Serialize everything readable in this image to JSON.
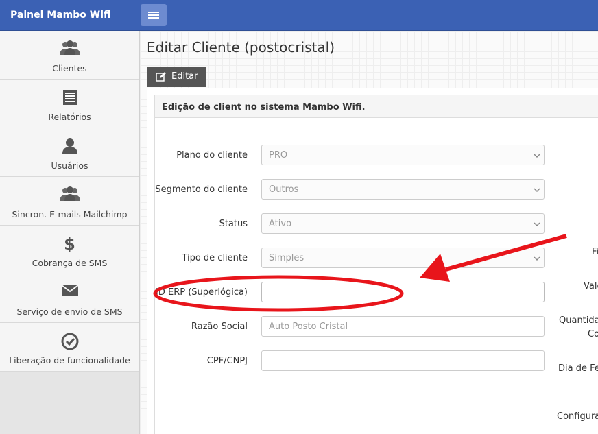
{
  "topbar": {
    "brand": "Painel Mambo Wifi"
  },
  "sidebar": {
    "items": [
      {
        "label": "Clientes",
        "icon": "users-icon"
      },
      {
        "label": "Relatórios",
        "icon": "document-icon"
      },
      {
        "label": "Usuários",
        "icon": "user-icon"
      },
      {
        "label": "Sincron. E-mails Mailchimp",
        "icon": "users-icon"
      },
      {
        "label": "Cobrança de SMS",
        "icon": "dollar-icon"
      },
      {
        "label": "Serviço de envio de SMS",
        "icon": "envelope-icon"
      },
      {
        "label": "Liberação de funcionalidade",
        "icon": "check-circle-icon"
      }
    ]
  },
  "main": {
    "title": "Editar Cliente (postocristal)",
    "tab_label": "Editar",
    "panel_heading": "Edição de client no sistema Mambo Wifi.",
    "form": {
      "plano_label": "Plano do cliente",
      "plano_value": "PRO",
      "segmento_label": "Segmento do cliente",
      "segmento_value": "Outros",
      "status_label": "Status",
      "status_value": "Ativo",
      "tipo_label": "Tipo de cliente",
      "tipo_value": "Simples",
      "id_erp_label": "ID ERP (Superlógica)",
      "id_erp_value": "",
      "razao_label": "Razão Social",
      "razao_value": "Auto Posto Cristal",
      "cpf_label": "CPF/CNPJ",
      "cpf_value": ""
    },
    "right_labels": [
      "Fi",
      "Valo",
      "Quantida",
      "Co",
      "Dia de Fec",
      "Configura"
    ]
  },
  "colors": {
    "topbar": "#3b61b4",
    "annotation": "#e8151b"
  }
}
